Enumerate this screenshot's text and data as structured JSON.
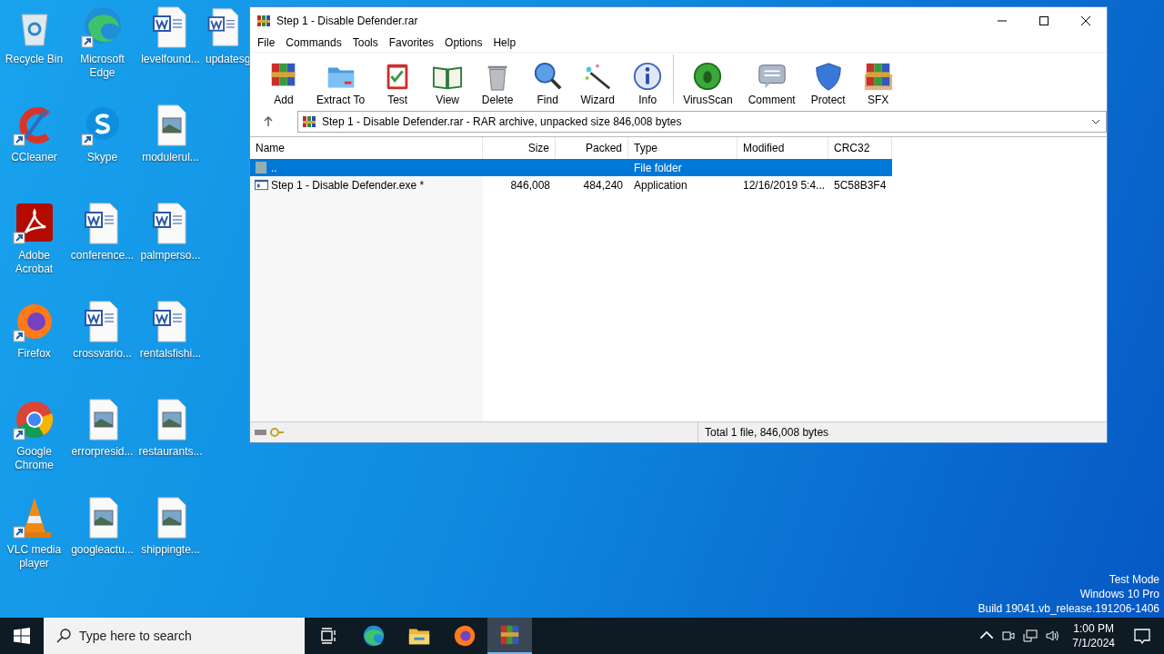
{
  "desktop_icons": [
    {
      "label": "Recycle Bin",
      "kind": "recycle-bin",
      "shortcut": false
    },
    {
      "label": "CCleaner",
      "kind": "ccleaner",
      "shortcut": true
    },
    {
      "label": "Adobe Acrobat",
      "kind": "acrobat",
      "shortcut": true
    },
    {
      "label": "Firefox",
      "kind": "firefox",
      "shortcut": true
    },
    {
      "label": "Google Chrome",
      "kind": "chrome",
      "shortcut": true
    },
    {
      "label": "VLC media player",
      "kind": "vlc",
      "shortcut": true
    },
    {
      "label": "Microsoft Edge",
      "kind": "edge",
      "shortcut": true
    },
    {
      "label": "Skype",
      "kind": "skype",
      "shortcut": true
    },
    {
      "label": "conference...",
      "kind": "word",
      "shortcut": false
    },
    {
      "label": "crossvario...",
      "kind": "word",
      "shortcut": false
    },
    {
      "label": "errorpresid...",
      "kind": "image",
      "shortcut": false
    },
    {
      "label": "googleactu...",
      "kind": "image",
      "shortcut": false
    },
    {
      "label": "levelfound...",
      "kind": "word",
      "shortcut": false
    },
    {
      "label": "modulerul...",
      "kind": "image",
      "shortcut": false
    },
    {
      "label": "palmperso...",
      "kind": "word",
      "shortcut": false
    },
    {
      "label": "rentalsfishi...",
      "kind": "word",
      "shortcut": false
    },
    {
      "label": "restaurants...",
      "kind": "image",
      "shortcut": false
    },
    {
      "label": "shippingte...",
      "kind": "image",
      "shortcut": false
    },
    {
      "label": "updatesg",
      "kind": "word",
      "shortcut": false
    }
  ],
  "window": {
    "title": "Step 1 - Disable Defender.rar",
    "menu": [
      "File",
      "Commands",
      "Tools",
      "Favorites",
      "Options",
      "Help"
    ],
    "toolbar": [
      {
        "label": "Add",
        "kind": "add"
      },
      {
        "label": "Extract To",
        "kind": "extract"
      },
      {
        "label": "Test",
        "kind": "test"
      },
      {
        "label": "View",
        "kind": "view"
      },
      {
        "label": "Delete",
        "kind": "delete"
      },
      {
        "label": "Find",
        "kind": "find"
      },
      {
        "label": "Wizard",
        "kind": "wizard"
      },
      {
        "label": "Info",
        "kind": "info"
      },
      {
        "label": "VirusScan",
        "kind": "virus"
      },
      {
        "label": "Comment",
        "kind": "comment"
      },
      {
        "label": "Protect",
        "kind": "protect"
      },
      {
        "label": "SFX",
        "kind": "sfx"
      }
    ],
    "address": "Step 1 - Disable Defender.rar - RAR archive, unpacked size 846,008 bytes",
    "table": {
      "columns": [
        "Name",
        "Size",
        "Packed",
        "Type",
        "Modified",
        "CRC32"
      ],
      "rows": [
        {
          "kind": "parent",
          "name": "..",
          "size": "",
          "packed": "",
          "type": "File folder",
          "modified": "",
          "crc": "",
          "selected": true
        },
        {
          "kind": "file",
          "name": "Step 1 - Disable Defender.exe *",
          "size": "846,008",
          "packed": "484,240",
          "type": "Application",
          "modified": "12/16/2019 5:4...",
          "crc": "5C58B3F4",
          "selected": false
        }
      ]
    },
    "status": "Total 1 file, 846,008 bytes"
  },
  "watermark_lines": [
    "Test Mode",
    "Windows 10 Pro",
    "Build 19041.vb_release.191206-1406"
  ],
  "taskbar": {
    "search_placeholder": "Type here to search",
    "apps": [
      {
        "kind": "edge",
        "active": false
      },
      {
        "kind": "explorer",
        "active": false
      },
      {
        "kind": "firefox",
        "active": false
      },
      {
        "kind": "winrar",
        "active": true
      }
    ],
    "time": "1:00 PM",
    "date": "7/1/2024"
  }
}
